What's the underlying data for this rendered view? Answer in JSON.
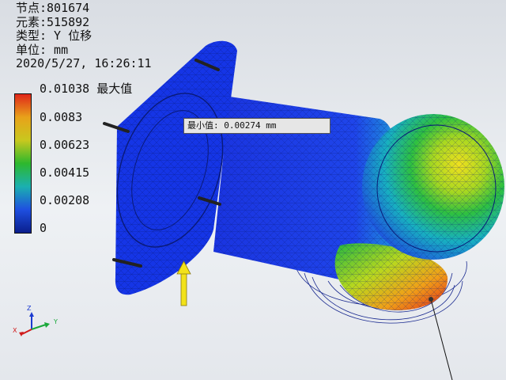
{
  "info": {
    "nodes": "节点:801674",
    "elements": "元素:515892",
    "type": "类型: Y 位移",
    "unit": "单位: mm",
    "datetime": "2020/5/27, 16:26:11"
  },
  "legend": {
    "max_label": "0.01038 最大值",
    "ticks": [
      "0.0083",
      "0.00623",
      "0.00415",
      "0.00208",
      "0"
    ],
    "colors": [
      "#e0261a",
      "#e8a21a",
      "#c8c81e",
      "#2db82d",
      "#1bb0b0",
      "#1e4fe0",
      "#0a1e8c"
    ]
  },
  "probe": {
    "min_label": "最小值: 0.00274 mm"
  },
  "triad": {
    "x": "X",
    "y": "Y",
    "z": "Z"
  },
  "colors": {
    "mesh_blue": "#1535e6",
    "arrow_yellow": "#f2e21a",
    "background": "#e4e7ec"
  }
}
